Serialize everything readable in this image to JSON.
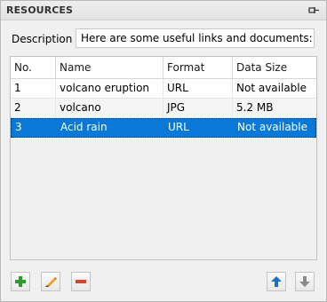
{
  "panel": {
    "title": "RESOURCES"
  },
  "description": {
    "label": "Description",
    "value": "Here are some useful links and documents:"
  },
  "table": {
    "columns": [
      "No.",
      "Name",
      "Format",
      "Data Size"
    ],
    "rows": [
      {
        "no": "1",
        "name": "volcano eruption",
        "format": "URL",
        "size": "Not available"
      },
      {
        "no": "2",
        "name": "volcano",
        "format": "JPG",
        "size": "5.2 MB"
      },
      {
        "no": "3",
        "name": "Acid rain",
        "format": "URL",
        "size": "Not available",
        "selected": true
      }
    ]
  },
  "toolbar": {
    "add_icon": "plus-icon",
    "edit_icon": "pencil-icon",
    "remove_icon": "minus-icon",
    "move_up_icon": "arrow-up-icon",
    "move_down_icon": "arrow-down-icon"
  },
  "colors": {
    "selection": "#0a78d7",
    "add": "#2e9b2e",
    "remove": "#d8402f",
    "edit": "#f0a020",
    "move_up": "#1c6fc4",
    "move_down": "#8a8a8a"
  }
}
